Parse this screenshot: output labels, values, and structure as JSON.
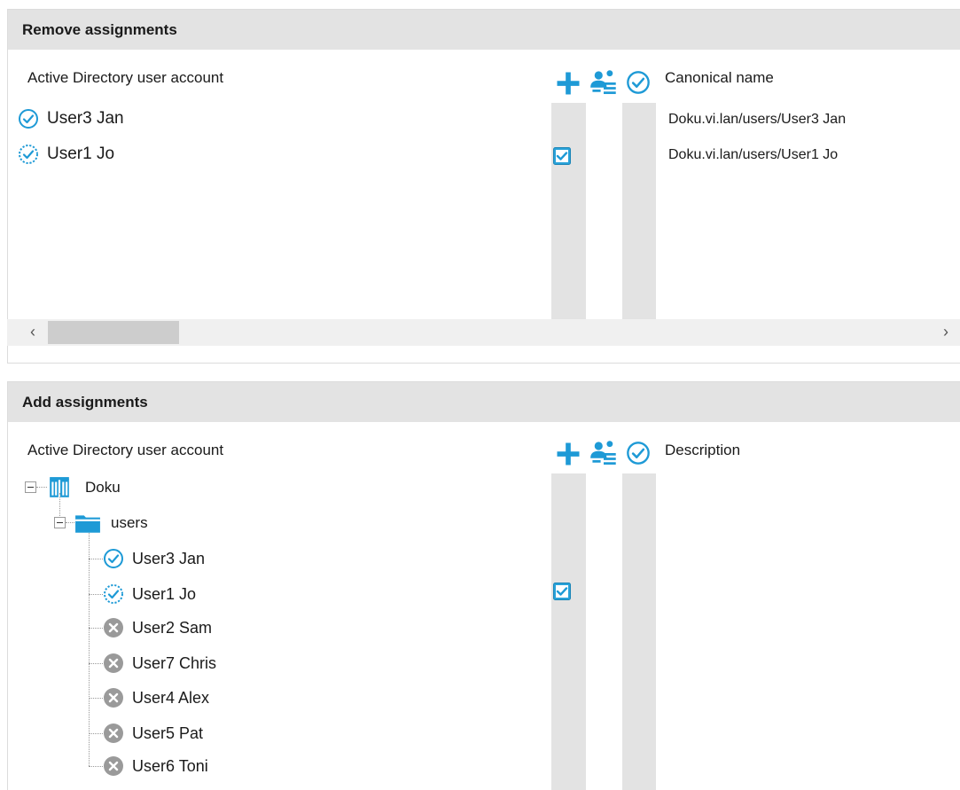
{
  "remove": {
    "title": "Remove assignments",
    "col_account": "Active Directory user account",
    "col_canonical": "Canonical name",
    "rows": [
      {
        "name": "User3 Jan",
        "canonical": "Doku.vi.lan/users/User3 Jan",
        "status": "assigned",
        "checked": false
      },
      {
        "name": "User1 Jo",
        "canonical": "Doku.vi.lan/users/User1 Jo",
        "status": "pending",
        "checked": true
      }
    ],
    "scroll_left": "‹",
    "scroll_right": "›"
  },
  "add": {
    "title": "Add assignments",
    "col_account": "Active Directory user account",
    "col_description": "Description",
    "tree": {
      "domain": "Doku",
      "ou": "users",
      "users": [
        {
          "name": "User3 Jan",
          "status": "assigned",
          "checked": false
        },
        {
          "name": "User1 Jo",
          "status": "pending",
          "checked": true
        },
        {
          "name": "User2 Sam",
          "status": "not-assigned",
          "checked": false
        },
        {
          "name": "User7 Chris",
          "status": "not-assigned",
          "checked": false
        },
        {
          "name": "User4 Alex",
          "status": "not-assigned",
          "checked": false
        },
        {
          "name": "User5 Pat",
          "status": "not-assigned",
          "checked": false
        },
        {
          "name": "User6 Toni",
          "status": "not-assigned",
          "checked": false
        }
      ]
    }
  },
  "icons": {
    "add_column": "plus-icon",
    "manage_column": "user-group-icon",
    "status_column": "check-circle-icon",
    "domain": "domain-building-icon",
    "ou": "folder-icon",
    "assigned": "check-circle-icon",
    "pending": "dashed-check-circle-icon",
    "not_assigned": "x-circle-icon"
  },
  "colors": {
    "accent": "#1e9ad6",
    "header_bg": "#e3e3e3",
    "grey_icon": "#9a9a9a"
  }
}
